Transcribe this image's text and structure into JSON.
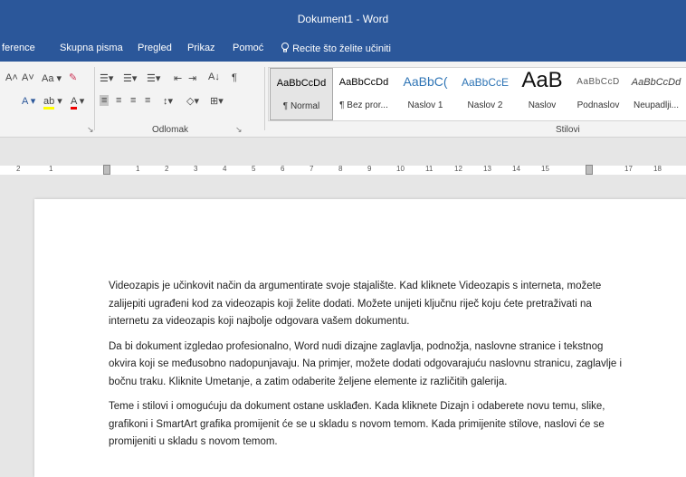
{
  "window": {
    "title": "Dokument1  -  Word"
  },
  "tabs": [
    {
      "label": "ference"
    },
    {
      "label": "Skupna pisma"
    },
    {
      "label": "Pregled"
    },
    {
      "label": "Prikaz"
    },
    {
      "label": "Pomoć"
    }
  ],
  "tell_me": {
    "label": "Recite što želite učiniti"
  },
  "groups": {
    "paragraph_label": "Odlomak",
    "styles_label": "Stilovi"
  },
  "styles": [
    {
      "sample": "AaBbCcDd",
      "name": "¶ Normal"
    },
    {
      "sample": "AaBbCcDd",
      "name": "¶ Bez pror..."
    },
    {
      "sample": "AaBbC(",
      "name": "Naslov 1"
    },
    {
      "sample": "AaBbCcE",
      "name": "Naslov 2"
    },
    {
      "sample": "AaB",
      "name": "Naslov"
    },
    {
      "sample": "AaBbCcD",
      "name": "Podnaslov"
    },
    {
      "sample": "AaBbCcDd",
      "name": "Neupadlji..."
    }
  ],
  "ruler": {
    "ticks": [
      "2",
      "1",
      "1",
      "2",
      "3",
      "4",
      "5",
      "6",
      "7",
      "8",
      "9",
      "10",
      "11",
      "12",
      "13",
      "14",
      "15",
      "17",
      "18"
    ]
  },
  "document": {
    "paragraphs": [
      "Videozapis je učinkovit način da argumentirate svoje stajalište. Kad kliknete Videozapis s interneta, možete zalijepiti ugrađeni kod za videozapis koji želite dodati. Možete unijeti ključnu riječ koju ćete pretraživati na internetu za videozapis koji najbolje odgovara vašem dokumentu.",
      "Da bi dokument izgledao profesionalno, Word nudi dizajne zaglavlja, podnožja, naslovne stranice i tekstnog okvira koji se međusobno nadopunjavaju. Na primjer, možete dodati odgovarajuću naslovnu stranicu, zaglavlje i bočnu traku. Kliknite Umetanje, a zatim odaberite željene elemente iz različitih galerija.",
      "Teme i stilovi i omogućuju da dokument ostane usklađen. Kada kliknete Dizajn i odaberete novu temu, slike, grafikoni i SmartArt grafika promijenit će se u skladu s novom temom. Kada primijenite stilove, naslovi će se promijeniti u skladu s novom temom."
    ]
  }
}
